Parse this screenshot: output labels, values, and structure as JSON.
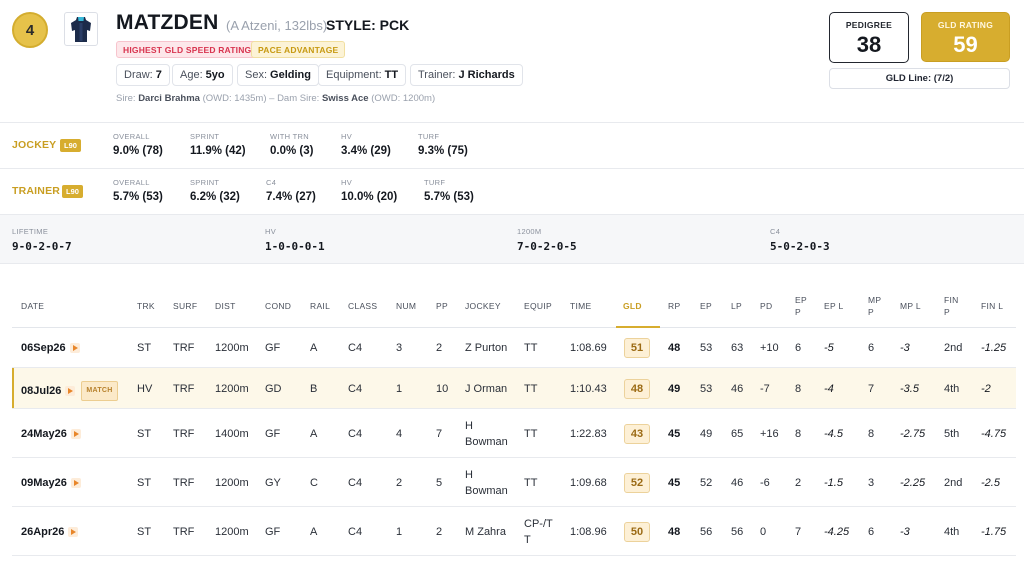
{
  "header": {
    "number": "4",
    "horse_name": "MATZDEN",
    "jockey_weight": "(A Atzeni, 132lbs)",
    "style_label": "STYLE:",
    "style_value": "PCK",
    "tags": [
      "HIGHEST GLD SPEED RATING",
      "PACE ADVANTAGE"
    ],
    "chips": [
      {
        "label": "Draw:",
        "value": "7"
      },
      {
        "label": "Age:",
        "value": "5yo"
      },
      {
        "label": "Sex:",
        "value": "Gelding"
      },
      {
        "label": "Equipment:",
        "value": "TT"
      },
      {
        "label": "Trainer:",
        "value": "J Richards"
      }
    ],
    "sire_label": "Sire:",
    "sire": "Darci Brahma",
    "sire_owd": "(OWD: 1435m)",
    "separator": "–",
    "dam_sire_label": "Dam Sire:",
    "dam_sire": "Swiss Ace",
    "dam_sire_owd": "(OWD: 1200m)",
    "pedigree_label": "PEDIGREE",
    "pedigree_value": "38",
    "gld_rating_label": "GLD RATING",
    "gld_rating_value": "59",
    "gld_line": "GLD Line: (7/2)"
  },
  "jockey": {
    "label": "JOCKEY",
    "badge": "L90",
    "stats": [
      {
        "label": "OVERALL",
        "value": "9.0% (78)"
      },
      {
        "label": "SPRINT",
        "value": "11.9% (42)"
      },
      {
        "label": "WITH TRN",
        "value": "0.0% (3)"
      },
      {
        "label": "HV",
        "value": "3.4% (29)"
      },
      {
        "label": "TURF",
        "value": "9.3% (75)"
      }
    ]
  },
  "trainer": {
    "label": "TRAINER",
    "badge": "L90",
    "stats": [
      {
        "label": "OVERALL",
        "value": "5.7% (53)"
      },
      {
        "label": "SPRINT",
        "value": "6.2% (32)"
      },
      {
        "label": "C4",
        "value": "7.4% (27)"
      },
      {
        "label": "HV",
        "value": "10.0% (20)"
      },
      {
        "label": "TURF",
        "value": "5.7% (53)"
      }
    ]
  },
  "records": [
    {
      "label": "LIFETIME",
      "value": "9-0-2-0-7"
    },
    {
      "label": "HV",
      "value": "1-0-0-0-1"
    },
    {
      "label": "1200M",
      "value": "7-0-2-0-5"
    },
    {
      "label": "C4",
      "value": "5-0-2-0-3"
    }
  ],
  "table": {
    "columns": [
      "DATE",
      "TRK",
      "SURF",
      "DIST",
      "COND",
      "RAIL",
      "CLASS",
      "NUM",
      "PP",
      "JOCKEY",
      "EQUIP",
      "TIME",
      "GLD",
      "RP",
      "EP",
      "LP",
      "PD",
      "EP P",
      "EP L",
      "MP P",
      "MP L",
      "FIN P",
      "FIN L"
    ],
    "match_label": "MATCH",
    "rows": [
      {
        "date": "06Sep26",
        "trk": "ST",
        "surf": "TRF",
        "dist": "1200m",
        "cond": "GF",
        "rail": "A",
        "class": "C4",
        "num": "3",
        "pp": "2",
        "jockey": "Z Purton",
        "equip": "TT",
        "time": "1:08.69",
        "gld": "51",
        "rp": "48",
        "ep": "53",
        "lp": "63",
        "pd": "+10",
        "epp": "6",
        "epl": "-5",
        "mpp": "6",
        "mpl": "-3",
        "finp": "2nd",
        "finl": "-1.25"
      },
      {
        "date": "08Jul26",
        "trk": "HV",
        "surf": "TRF",
        "dist": "1200m",
        "cond": "GD",
        "rail": "B",
        "class": "C4",
        "num": "1",
        "pp": "10",
        "jockey": "J Orman",
        "equip": "TT",
        "time": "1:10.43",
        "gld": "48",
        "rp": "49",
        "ep": "53",
        "lp": "46",
        "pd": "-7",
        "epp": "8",
        "epl": "-4",
        "mpp": "7",
        "mpl": "-3.5",
        "finp": "4th",
        "finl": "-2"
      },
      {
        "date": "24May26",
        "trk": "ST",
        "surf": "TRF",
        "dist": "1400m",
        "cond": "GF",
        "rail": "A",
        "class": "C4",
        "num": "4",
        "pp": "7",
        "jockey": "H Bowman",
        "equip": "TT",
        "time": "1:22.83",
        "gld": "43",
        "rp": "45",
        "ep": "49",
        "lp": "65",
        "pd": "+16",
        "epp": "8",
        "epl": "-4.5",
        "mpp": "8",
        "mpl": "-2.75",
        "finp": "5th",
        "finl": "-4.75"
      },
      {
        "date": "09May26",
        "trk": "ST",
        "surf": "TRF",
        "dist": "1200m",
        "cond": "GY",
        "rail": "C",
        "class": "C4",
        "num": "2",
        "pp": "5",
        "jockey": "H Bowman",
        "equip": "TT",
        "time": "1:09.68",
        "gld": "52",
        "rp": "45",
        "ep": "52",
        "lp": "46",
        "pd": "-6",
        "epp": "2",
        "epl": "-1.5",
        "mpp": "3",
        "mpl": "-2.25",
        "finp": "2nd",
        "finl": "-2.5"
      },
      {
        "date": "26Apr26",
        "trk": "ST",
        "surf": "TRF",
        "dist": "1200m",
        "cond": "GF",
        "rail": "A",
        "class": "C4",
        "num": "1",
        "pp": "2",
        "jockey": "M Zahra",
        "equip": "CP-/TT",
        "time": "1:08.96",
        "gld": "50",
        "rp": "48",
        "ep": "56",
        "lp": "56",
        "pd": "0",
        "epp": "7",
        "epl": "-4.25",
        "mpp": "6",
        "mpl": "-3",
        "finp": "4th",
        "finl": "-1.75"
      }
    ]
  }
}
